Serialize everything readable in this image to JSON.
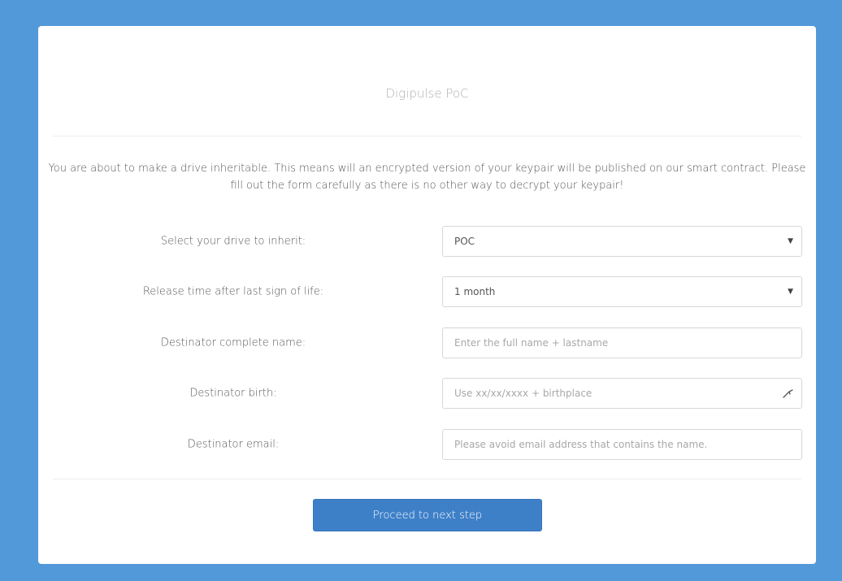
{
  "header": {
    "title": "Digipulse PoC"
  },
  "intro": {
    "text": "You are about to make a drive inheritable. This means will an encrypted version of your keypair will be published on our smart contract. Please fill out the form carefully as there is no other way to decrypt your keypair!"
  },
  "form": {
    "drive": {
      "label": "Select your drive to inherit:",
      "value": "POC"
    },
    "release_time": {
      "label": "Release time after last sign of life:",
      "value": "1 month"
    },
    "name": {
      "label": "Destinator complete name:",
      "placeholder": "Enter the full name + lastname"
    },
    "birth": {
      "label": "Destinator birth:",
      "placeholder": "Use xx/xx/xxxx + birthplace"
    },
    "email": {
      "label": "Destinator email:",
      "placeholder": "Please avoid email address that contains the name."
    }
  },
  "actions": {
    "proceed_label": "Proceed to next step"
  },
  "colors": {
    "background": "#5299d9",
    "button": "#3e80c8"
  }
}
